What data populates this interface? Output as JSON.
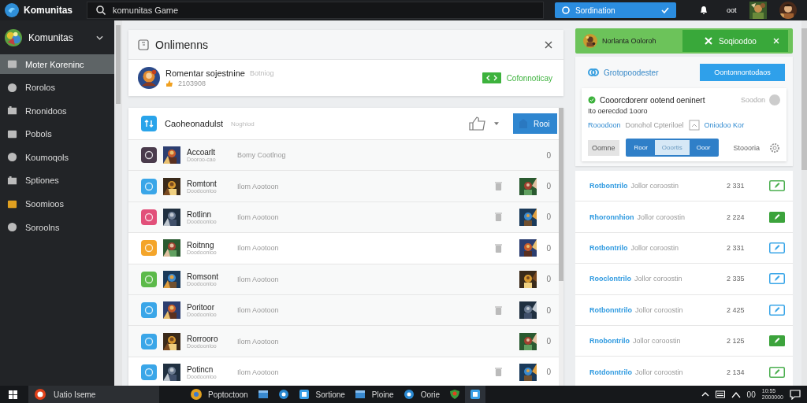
{
  "topbar": {
    "app_name": "Komunitas",
    "search": {
      "value": "komunitas Game"
    },
    "dropdown": {
      "label": "Sordination"
    },
    "status_text": "oot"
  },
  "sidebar": {
    "profile_name": "Komunitas",
    "items": [
      {
        "label": "Moter Koreninc",
        "selected": true
      },
      {
        "label": "Rorolos",
        "selected": false
      },
      {
        "label": "Rnonidoos",
        "selected": false
      },
      {
        "label": "Pobols",
        "selected": false
      },
      {
        "label": "Koumoqols",
        "selected": false
      },
      {
        "label": "Sptiones",
        "selected": false
      },
      {
        "label": "Soomioos",
        "selected": false
      },
      {
        "label": "Soroolns",
        "selected": false
      }
    ]
  },
  "panel": {
    "title": "Onlimenns",
    "profile": {
      "name": "Romentar sojestnine",
      "tag": "Botniog",
      "meta": "2103908",
      "action_label": "Cofonnoticay"
    }
  },
  "list": {
    "title": "Caoheonadulst",
    "subtitle": "Noghiod",
    "action_label": "Rooi",
    "rows": [
      {
        "color": "#4a3b4c",
        "name": "Accoarlt",
        "sub": "Dooroo-cao",
        "desc": "Bomy Cootlnog",
        "count": "0",
        "trash": false
      },
      {
        "color": "#3aa6e8",
        "name": "Romtont",
        "sub": "Doodoonloo",
        "desc": "Ilom Aootoon",
        "count": "0",
        "trash": true
      },
      {
        "color": "#e2507a",
        "name": "Rotlinn",
        "sub": "Doodoonloo",
        "desc": "Ilom Aootoon",
        "count": "0",
        "trash": true
      },
      {
        "color": "#f4a52a",
        "name": "Roitnng",
        "sub": "Doodoonloo",
        "desc": "Ilom Aootoon",
        "count": "0",
        "trash": true
      },
      {
        "color": "#5cba4a",
        "name": "Romsont",
        "sub": "Doodoonloo",
        "desc": "Ilom Aootoon",
        "count": "0",
        "trash": false
      },
      {
        "color": "#3aa6e8",
        "name": "Poritoor",
        "sub": "Doodoonloo",
        "desc": "Ilom Aootoon",
        "count": "0",
        "trash": true
      },
      {
        "color": "#3aa6e8",
        "name": "Rorrooro",
        "sub": "Doodoonloo",
        "desc": "Ilom Aootoon",
        "count": "0",
        "trash": false
      },
      {
        "color": "#3aa6e8",
        "name": "Potincn",
        "sub": "Doodoonloo",
        "desc": "Ilom Aootoon",
        "count": "0",
        "trash": true
      }
    ]
  },
  "banner": {
    "title": "Norlanta Ooloroh",
    "button_label": "Soqioodoo"
  },
  "detail": {
    "title": "Grotopoodester",
    "button_label": "Oontonnontodaos",
    "headline": "Cooorcdorenr ootend oeninert",
    "status": "Soodon",
    "note": "Ito oerecdod 1ooro",
    "links": [
      {
        "label": "Rooodoon",
        "kind": "link"
      },
      {
        "label": "Donohol Cpteriloel",
        "kind": "text"
      },
      {
        "label": "Oniodoo Kor",
        "kind": "link"
      }
    ],
    "cancel_label": "Oomne",
    "segments": [
      {
        "label": "Roor",
        "selected": false
      },
      {
        "label": "Ooortis",
        "selected": true
      },
      {
        "label": "Ooor",
        "selected": false
      }
    ],
    "sort_label": "Stoooria"
  },
  "entries": [
    {
      "name": "Rotbontrilo",
      "desc": "Jollor coroostin",
      "value": "2 331",
      "kind": "outline",
      "color": "#4caf50"
    },
    {
      "name": "Rhoronnhion",
      "desc": "Jollor coroostin",
      "value": "2 224",
      "kind": "filled",
      "color": "#3ca33c"
    },
    {
      "name": "Rotbontrilo",
      "desc": "Jollor coroostin",
      "value": "2 331",
      "kind": "outline",
      "color": "#3aa6e8"
    },
    {
      "name": "Rooclontrilo",
      "desc": "Jollor coroostin",
      "value": "2 335",
      "kind": "outline",
      "color": "#3aa6e8"
    },
    {
      "name": "Rotbonntrilo",
      "desc": "Jollor coroostin",
      "value": "2 425",
      "kind": "outline",
      "color": "#3aa6e8"
    },
    {
      "name": "Rnobontrilo",
      "desc": "Jollor coroostin",
      "value": "2 125",
      "kind": "filled",
      "color": "#3ca33c"
    },
    {
      "name": "Rotdonntrilo",
      "desc": "Jollor coroostin",
      "value": "2 134",
      "kind": "outline",
      "color": "#4caf50"
    }
  ],
  "taskbar": {
    "search_label": "Uatio Iseme",
    "apps": [
      {
        "label": "Poptoctoon",
        "kind": "browser"
      },
      {
        "kind": "folder"
      },
      {
        "kind": "circle"
      },
      {
        "label": "Sortione",
        "kind": "square"
      },
      {
        "label": "Ploine",
        "kind": "folder"
      },
      {
        "label": "Oorie",
        "kind": "circle"
      },
      {
        "kind": "shield"
      },
      {
        "kind": "square"
      }
    ],
    "tray_text": "00",
    "time": "10:55",
    "date": "2000000"
  }
}
